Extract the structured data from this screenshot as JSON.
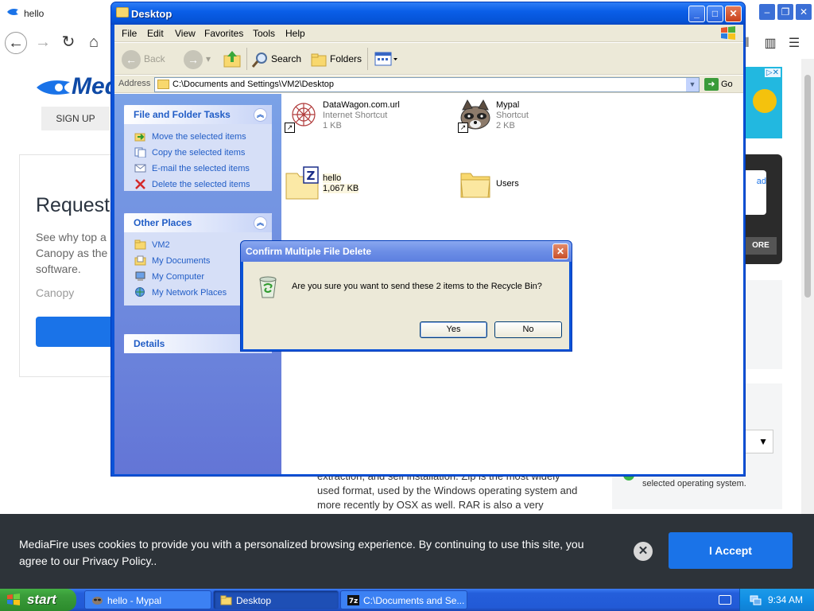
{
  "browser": {
    "tab_title": "hello",
    "nav_back": "←",
    "nav_forward": "→",
    "nav_reload": "↻",
    "nav_home": "⌂",
    "win_min": "–",
    "win_max": "❐",
    "win_close": "✕",
    "page": {
      "logo_text": "Med",
      "sign_up": "SIGN UP",
      "request_heading": "Request",
      "see_text": "See why top a Canopy as the software.",
      "canopy_label": "Canopy",
      "article_text": "extraction, and self installation. Zip is the most widely used format, used by the Windows operating system and more recently by OSX as well. RAR is also a very",
      "ad_tag": "▷✕",
      "dark_card_text": "ad",
      "dark_card_button": "ORE",
      "select_value": "▼",
      "side_text": "selected operating system."
    },
    "cookie": {
      "text": "MediaFire uses cookies to provide you with a personalized browsing experience. By continuing to use this site, you agree to our Privacy Policy..",
      "close_label": "✕",
      "accept_label": "I Accept"
    }
  },
  "explorer": {
    "title": "Desktop",
    "caption_min": "_",
    "caption_max": "□",
    "caption_close": "✕",
    "menu": [
      "File",
      "Edit",
      "View",
      "Favorites",
      "Tools",
      "Help"
    ],
    "toolbar": {
      "back": "Back",
      "search": "Search",
      "folders": "Folders"
    },
    "address": {
      "label": "Address",
      "value": "C:\\Documents and Settings\\VM2\\Desktop",
      "go": "Go"
    },
    "file_tasks": {
      "title": "File and Folder Tasks",
      "items": [
        "Move the selected items",
        "Copy the selected items",
        "E-mail the selected items",
        "Delete the selected items"
      ]
    },
    "other_places": {
      "title": "Other Places",
      "items": [
        "VM2",
        "My Documents",
        "My Computer",
        "My Network Places"
      ]
    },
    "details": {
      "title": "Details"
    },
    "files": [
      {
        "name": "DataWagon.com.url",
        "type": "Internet Shortcut",
        "size": "1 KB"
      },
      {
        "name": "Mypal",
        "type": "Shortcut",
        "size": "2 KB"
      },
      {
        "name": "hello",
        "type": "",
        "size": "1,067 KB"
      },
      {
        "name": "Users",
        "type": "",
        "size": ""
      }
    ]
  },
  "dialog": {
    "title": "Confirm Multiple File Delete",
    "message": "Are you sure you want to send these 2 items to the Recycle Bin?",
    "yes": "Yes",
    "no": "No",
    "close": "✕"
  },
  "taskbar": {
    "start": "start",
    "tasks": [
      {
        "label": "hello - Mypal",
        "active": false
      },
      {
        "label": "Desktop",
        "active": true
      },
      {
        "label": "C:\\Documents and Se...",
        "active": false
      }
    ],
    "time": "9:34 AM"
  }
}
